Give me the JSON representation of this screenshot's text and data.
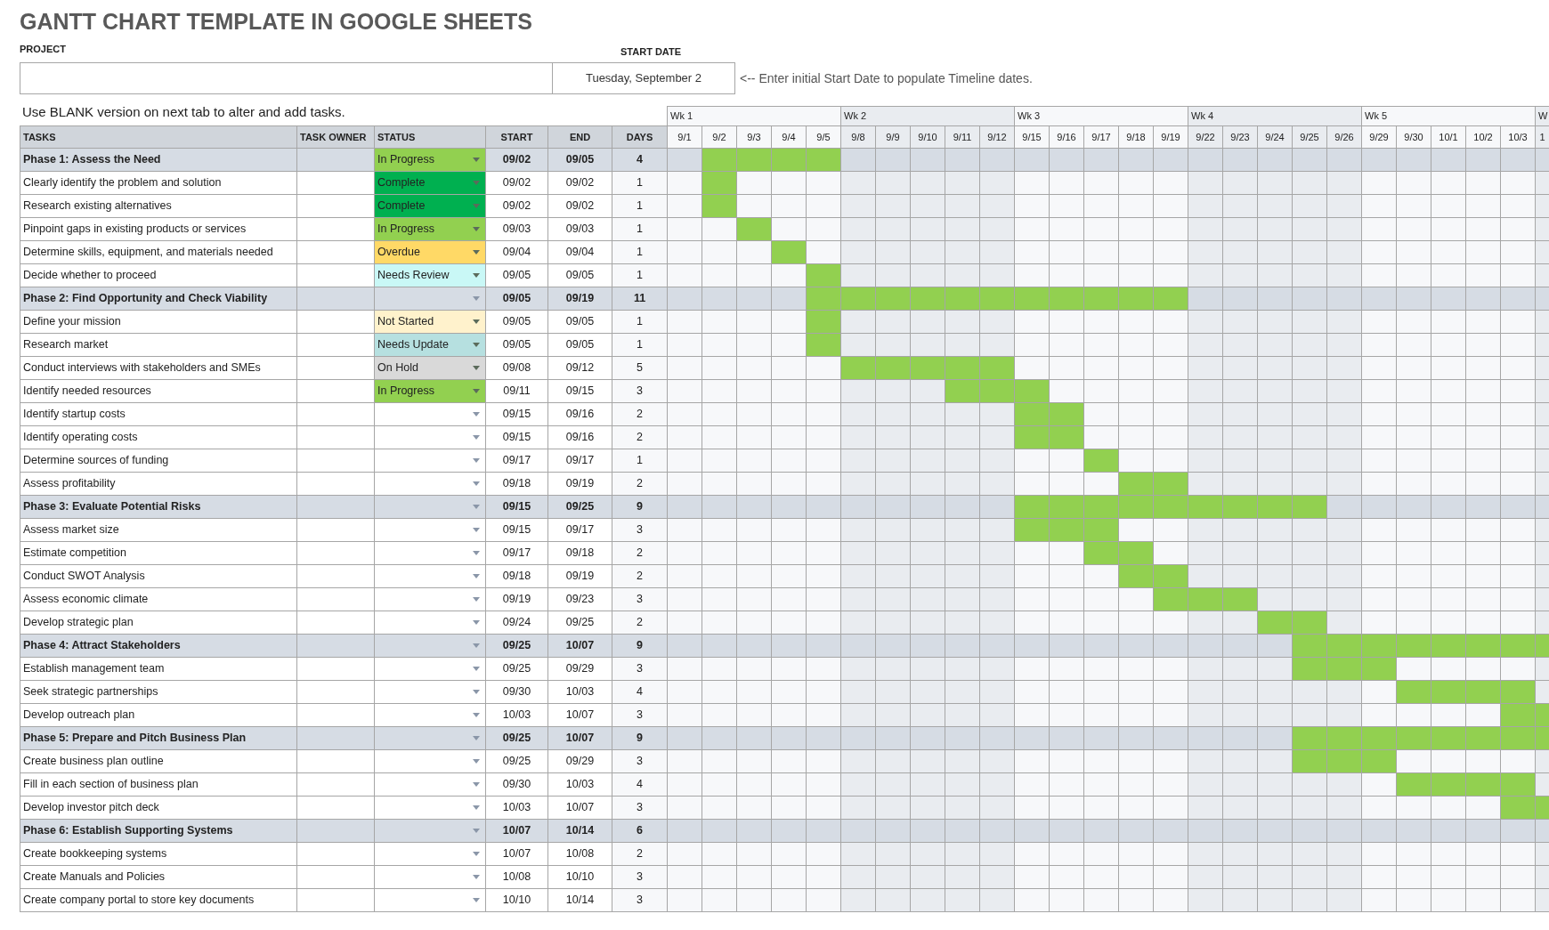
{
  "title": "GANTT CHART TEMPLATE IN GOOGLE SHEETS",
  "project": {
    "label": "PROJECT"
  },
  "start_date": {
    "label": "START DATE",
    "value": "Tuesday, September 2",
    "hint": "<-- Enter initial Start Date to populate Timeline dates."
  },
  "note": "Use BLANK version on next tab to alter and add tasks.",
  "columns": [
    "TASKS",
    "TASK OWNER",
    "STATUS",
    "START",
    "END",
    "DAYS"
  ],
  "weeks": [
    {
      "label": "Wk 1",
      "days": [
        "9/1",
        "9/2",
        "9/3",
        "9/4",
        "9/5"
      ]
    },
    {
      "label": "Wk 2",
      "days": [
        "9/8",
        "9/9",
        "9/10",
        "9/11",
        "9/12"
      ]
    },
    {
      "label": "Wk 3",
      "days": [
        "9/15",
        "9/16",
        "9/17",
        "9/18",
        "9/19"
      ]
    },
    {
      "label": "Wk 4",
      "days": [
        "9/22",
        "9/23",
        "9/24",
        "9/25",
        "9/26"
      ]
    },
    {
      "label": "Wk 5",
      "days": [
        "9/29",
        "9/30",
        "10/1",
        "10/2",
        "10/3"
      ]
    },
    {
      "label": "W",
      "days": [
        "1"
      ]
    }
  ],
  "rows": [
    {
      "kind": "phase",
      "task": "Phase 1: Assess the Need",
      "status": "In Progress",
      "color": "#92d050",
      "start": "09/02",
      "end": "09/05",
      "days": "4",
      "timeline": [
        false,
        true,
        true,
        true,
        true,
        false,
        false,
        false,
        false,
        false,
        false,
        false,
        false,
        false,
        false,
        false,
        false,
        false,
        false,
        false,
        false,
        false,
        false,
        false,
        false,
        false
      ]
    },
    {
      "kind": "task",
      "task": "Clearly identify the problem and solution",
      "status": "Complete",
      "color": "#00b050",
      "start": "09/02",
      "end": "09/02",
      "days": "1",
      "timeline": [
        false,
        true,
        false,
        false,
        false,
        false,
        false,
        false,
        false,
        false,
        false,
        false,
        false,
        false,
        false,
        false,
        false,
        false,
        false,
        false,
        false,
        false,
        false,
        false,
        false,
        false
      ]
    },
    {
      "kind": "task",
      "task": "Research existing alternatives",
      "status": "Complete",
      "color": "#00b050",
      "start": "09/02",
      "end": "09/02",
      "days": "1",
      "timeline": [
        false,
        true,
        false,
        false,
        false,
        false,
        false,
        false,
        false,
        false,
        false,
        false,
        false,
        false,
        false,
        false,
        false,
        false,
        false,
        false,
        false,
        false,
        false,
        false,
        false,
        false
      ]
    },
    {
      "kind": "task",
      "task": "Pinpoint gaps in existing products or services",
      "status": "In Progress",
      "color": "#92d050",
      "start": "09/03",
      "end": "09/03",
      "days": "1",
      "timeline": [
        false,
        false,
        true,
        false,
        false,
        false,
        false,
        false,
        false,
        false,
        false,
        false,
        false,
        false,
        false,
        false,
        false,
        false,
        false,
        false,
        false,
        false,
        false,
        false,
        false,
        false
      ]
    },
    {
      "kind": "task",
      "task": "Determine skills, equipment, and materials needed",
      "status": "Overdue",
      "color": "#ffd966",
      "start": "09/04",
      "end": "09/04",
      "days": "1",
      "timeline": [
        false,
        false,
        false,
        true,
        false,
        false,
        false,
        false,
        false,
        false,
        false,
        false,
        false,
        false,
        false,
        false,
        false,
        false,
        false,
        false,
        false,
        false,
        false,
        false,
        false,
        false
      ]
    },
    {
      "kind": "task",
      "task": "Decide whether to proceed",
      "status": "Needs Review",
      "color": "#c9f8f6",
      "start": "09/05",
      "end": "09/05",
      "days": "1",
      "timeline": [
        false,
        false,
        false,
        false,
        true,
        false,
        false,
        false,
        false,
        false,
        false,
        false,
        false,
        false,
        false,
        false,
        false,
        false,
        false,
        false,
        false,
        false,
        false,
        false,
        false,
        false
      ]
    },
    {
      "kind": "phase",
      "task": "Phase 2: Find Opportunity and Check Viability",
      "start": "09/05",
      "end": "09/19",
      "days": "11",
      "timeline": [
        false,
        false,
        false,
        false,
        true,
        true,
        true,
        true,
        true,
        true,
        true,
        true,
        true,
        true,
        true,
        false,
        false,
        false,
        false,
        false,
        false,
        false,
        false,
        false,
        false,
        false
      ]
    },
    {
      "kind": "task",
      "task": "Define your mission",
      "status": "Not Started",
      "color": "#fff2cc",
      "start": "09/05",
      "end": "09/05",
      "days": "1",
      "timeline": [
        false,
        false,
        false,
        false,
        true,
        false,
        false,
        false,
        false,
        false,
        false,
        false,
        false,
        false,
        false,
        false,
        false,
        false,
        false,
        false,
        false,
        false,
        false,
        false,
        false,
        false
      ]
    },
    {
      "kind": "task",
      "task": "Research market",
      "status": "Needs Update",
      "color": "#b6e0e0",
      "start": "09/05",
      "end": "09/05",
      "days": "1",
      "timeline": [
        false,
        false,
        false,
        false,
        true,
        false,
        false,
        false,
        false,
        false,
        false,
        false,
        false,
        false,
        false,
        false,
        false,
        false,
        false,
        false,
        false,
        false,
        false,
        false,
        false,
        false
      ]
    },
    {
      "kind": "task",
      "task": "Conduct interviews with stakeholders and SMEs",
      "status": "On Hold",
      "color": "#d9d9d9",
      "start": "09/08",
      "end": "09/12",
      "days": "5",
      "timeline": [
        false,
        false,
        false,
        false,
        false,
        true,
        true,
        true,
        true,
        true,
        false,
        false,
        false,
        false,
        false,
        false,
        false,
        false,
        false,
        false,
        false,
        false,
        false,
        false,
        false,
        false
      ]
    },
    {
      "kind": "task",
      "task": "Identify needed resources",
      "status": "In Progress",
      "color": "#92d050",
      "start": "09/11",
      "end": "09/15",
      "days": "3",
      "timeline": [
        false,
        false,
        false,
        false,
        false,
        false,
        false,
        false,
        true,
        true,
        true,
        false,
        false,
        false,
        false,
        false,
        false,
        false,
        false,
        false,
        false,
        false,
        false,
        false,
        false,
        false
      ]
    },
    {
      "kind": "task",
      "task": "Identify startup costs",
      "start": "09/15",
      "end": "09/16",
      "days": "2",
      "timeline": [
        false,
        false,
        false,
        false,
        false,
        false,
        false,
        false,
        false,
        false,
        true,
        true,
        false,
        false,
        false,
        false,
        false,
        false,
        false,
        false,
        false,
        false,
        false,
        false,
        false,
        false
      ]
    },
    {
      "kind": "task",
      "task": "Identify operating costs",
      "start": "09/15",
      "end": "09/16",
      "days": "2",
      "timeline": [
        false,
        false,
        false,
        false,
        false,
        false,
        false,
        false,
        false,
        false,
        true,
        true,
        false,
        false,
        false,
        false,
        false,
        false,
        false,
        false,
        false,
        false,
        false,
        false,
        false,
        false
      ]
    },
    {
      "kind": "task",
      "task": "Determine sources of funding",
      "start": "09/17",
      "end": "09/17",
      "days": "1",
      "timeline": [
        false,
        false,
        false,
        false,
        false,
        false,
        false,
        false,
        false,
        false,
        false,
        false,
        true,
        false,
        false,
        false,
        false,
        false,
        false,
        false,
        false,
        false,
        false,
        false,
        false,
        false
      ]
    },
    {
      "kind": "task",
      "task": "Assess profitability",
      "start": "09/18",
      "end": "09/19",
      "days": "2",
      "timeline": [
        false,
        false,
        false,
        false,
        false,
        false,
        false,
        false,
        false,
        false,
        false,
        false,
        false,
        true,
        true,
        false,
        false,
        false,
        false,
        false,
        false,
        false,
        false,
        false,
        false,
        false
      ]
    },
    {
      "kind": "phase",
      "task": "Phase 3: Evaluate Potential Risks",
      "start": "09/15",
      "end": "09/25",
      "days": "9",
      "timeline": [
        false,
        false,
        false,
        false,
        false,
        false,
        false,
        false,
        false,
        false,
        true,
        true,
        true,
        true,
        true,
        true,
        true,
        true,
        true,
        false,
        false,
        false,
        false,
        false,
        false,
        false
      ]
    },
    {
      "kind": "task",
      "task": "Assess market size",
      "start": "09/15",
      "end": "09/17",
      "days": "3",
      "timeline": [
        false,
        false,
        false,
        false,
        false,
        false,
        false,
        false,
        false,
        false,
        true,
        true,
        true,
        false,
        false,
        false,
        false,
        false,
        false,
        false,
        false,
        false,
        false,
        false,
        false,
        false
      ]
    },
    {
      "kind": "task",
      "task": "Estimate competition",
      "start": "09/17",
      "end": "09/18",
      "days": "2",
      "timeline": [
        false,
        false,
        false,
        false,
        false,
        false,
        false,
        false,
        false,
        false,
        false,
        false,
        true,
        true,
        false,
        false,
        false,
        false,
        false,
        false,
        false,
        false,
        false,
        false,
        false,
        false
      ]
    },
    {
      "kind": "task",
      "task": "Conduct SWOT Analysis",
      "start": "09/18",
      "end": "09/19",
      "days": "2",
      "timeline": [
        false,
        false,
        false,
        false,
        false,
        false,
        false,
        false,
        false,
        false,
        false,
        false,
        false,
        true,
        true,
        false,
        false,
        false,
        false,
        false,
        false,
        false,
        false,
        false,
        false,
        false
      ]
    },
    {
      "kind": "task",
      "task": "Assess economic climate",
      "start": "09/19",
      "end": "09/23",
      "days": "3",
      "timeline": [
        false,
        false,
        false,
        false,
        false,
        false,
        false,
        false,
        false,
        false,
        false,
        false,
        false,
        false,
        true,
        true,
        true,
        false,
        false,
        false,
        false,
        false,
        false,
        false,
        false,
        false
      ]
    },
    {
      "kind": "task",
      "task": "Develop strategic plan",
      "start": "09/24",
      "end": "09/25",
      "days": "2",
      "timeline": [
        false,
        false,
        false,
        false,
        false,
        false,
        false,
        false,
        false,
        false,
        false,
        false,
        false,
        false,
        false,
        false,
        false,
        true,
        true,
        false,
        false,
        false,
        false,
        false,
        false,
        false
      ]
    },
    {
      "kind": "phase",
      "task": "Phase 4: Attract Stakeholders",
      "start": "09/25",
      "end": "10/07",
      "days": "9",
      "timeline": [
        false,
        false,
        false,
        false,
        false,
        false,
        false,
        false,
        false,
        false,
        false,
        false,
        false,
        false,
        false,
        false,
        false,
        false,
        true,
        true,
        true,
        true,
        true,
        true,
        true,
        true
      ]
    },
    {
      "kind": "task",
      "task": "Establish management team",
      "start": "09/25",
      "end": "09/29",
      "days": "3",
      "timeline": [
        false,
        false,
        false,
        false,
        false,
        false,
        false,
        false,
        false,
        false,
        false,
        false,
        false,
        false,
        false,
        false,
        false,
        false,
        true,
        true,
        true,
        false,
        false,
        false,
        false,
        false
      ]
    },
    {
      "kind": "task",
      "task": "Seek strategic partnerships",
      "start": "09/30",
      "end": "10/03",
      "days": "4",
      "timeline": [
        false,
        false,
        false,
        false,
        false,
        false,
        false,
        false,
        false,
        false,
        false,
        false,
        false,
        false,
        false,
        false,
        false,
        false,
        false,
        false,
        false,
        true,
        true,
        true,
        true,
        false
      ]
    },
    {
      "kind": "task",
      "task": "Develop outreach plan",
      "start": "10/03",
      "end": "10/07",
      "days": "3",
      "timeline": [
        false,
        false,
        false,
        false,
        false,
        false,
        false,
        false,
        false,
        false,
        false,
        false,
        false,
        false,
        false,
        false,
        false,
        false,
        false,
        false,
        false,
        false,
        false,
        false,
        true,
        true
      ]
    },
    {
      "kind": "phase",
      "task": "Phase 5: Prepare and Pitch Business Plan",
      "start": "09/25",
      "end": "10/07",
      "days": "9",
      "timeline": [
        false,
        false,
        false,
        false,
        false,
        false,
        false,
        false,
        false,
        false,
        false,
        false,
        false,
        false,
        false,
        false,
        false,
        false,
        true,
        true,
        true,
        true,
        true,
        true,
        true,
        true
      ]
    },
    {
      "kind": "task",
      "task": "Create business plan outline",
      "start": "09/25",
      "end": "09/29",
      "days": "3",
      "timeline": [
        false,
        false,
        false,
        false,
        false,
        false,
        false,
        false,
        false,
        false,
        false,
        false,
        false,
        false,
        false,
        false,
        false,
        false,
        true,
        true,
        true,
        false,
        false,
        false,
        false,
        false
      ]
    },
    {
      "kind": "task",
      "task": "Fill in each section of business plan",
      "start": "09/30",
      "end": "10/03",
      "days": "4",
      "timeline": [
        false,
        false,
        false,
        false,
        false,
        false,
        false,
        false,
        false,
        false,
        false,
        false,
        false,
        false,
        false,
        false,
        false,
        false,
        false,
        false,
        false,
        true,
        true,
        true,
        true,
        false
      ]
    },
    {
      "kind": "task",
      "task": "Develop investor pitch deck",
      "start": "10/03",
      "end": "10/07",
      "days": "3",
      "timeline": [
        false,
        false,
        false,
        false,
        false,
        false,
        false,
        false,
        false,
        false,
        false,
        false,
        false,
        false,
        false,
        false,
        false,
        false,
        false,
        false,
        false,
        false,
        false,
        false,
        true,
        true
      ]
    },
    {
      "kind": "phase",
      "task": "Phase 6: Establish Supporting Systems",
      "start": "10/07",
      "end": "10/14",
      "days": "6",
      "timeline": [
        false,
        false,
        false,
        false,
        false,
        false,
        false,
        false,
        false,
        false,
        false,
        false,
        false,
        false,
        false,
        false,
        false,
        false,
        false,
        false,
        false,
        false,
        false,
        false,
        false,
        false
      ]
    },
    {
      "kind": "task",
      "task": "Create bookkeeping systems",
      "start": "10/07",
      "end": "10/08",
      "days": "2",
      "timeline": [
        false,
        false,
        false,
        false,
        false,
        false,
        false,
        false,
        false,
        false,
        false,
        false,
        false,
        false,
        false,
        false,
        false,
        false,
        false,
        false,
        false,
        false,
        false,
        false,
        false,
        false
      ]
    },
    {
      "kind": "task",
      "task": "Create Manuals and Policies",
      "start": "10/08",
      "end": "10/10",
      "days": "3",
      "timeline": [
        false,
        false,
        false,
        false,
        false,
        false,
        false,
        false,
        false,
        false,
        false,
        false,
        false,
        false,
        false,
        false,
        false,
        false,
        false,
        false,
        false,
        false,
        false,
        false,
        false,
        false
      ]
    },
    {
      "kind": "task",
      "task": "Create company portal to store key documents",
      "start": "10/10",
      "end": "10/14",
      "days": "3",
      "timeline": [
        false,
        false,
        false,
        false,
        false,
        false,
        false,
        false,
        false,
        false,
        false,
        false,
        false,
        false,
        false,
        false,
        false,
        false,
        false,
        false,
        false,
        false,
        false,
        false,
        false,
        false
      ]
    }
  ]
}
